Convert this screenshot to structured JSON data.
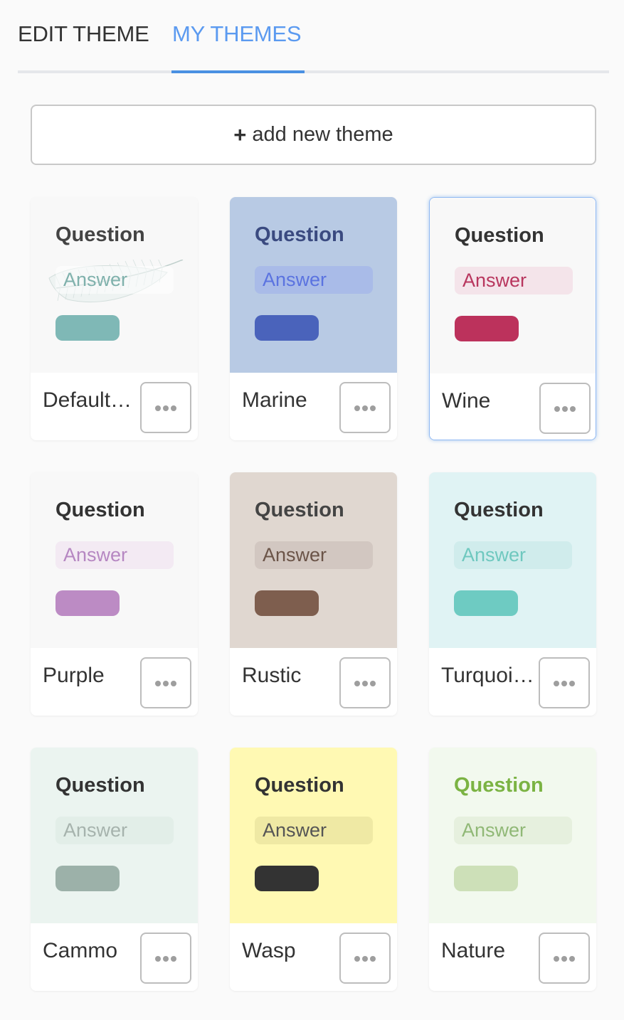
{
  "tabs": {
    "edit_theme": "EDIT THEME",
    "my_themes": "MY THEMES"
  },
  "add_button": {
    "plus": "+",
    "label": "add new theme"
  },
  "more_icon": "more-horizontal-icon",
  "themes": [
    {
      "name": "Default…",
      "question": "Question",
      "answer": "Answer",
      "colors": {
        "bg": "#f8f8f8",
        "question": "#444444",
        "answer_bg": "#ffffff",
        "answer_text": "#7fb1ac",
        "pill": "#7fb8b6"
      },
      "decoration": "feather-icon",
      "selected": false
    },
    {
      "name": "Marine",
      "question": "Question",
      "answer": "Answer",
      "colors": {
        "bg": "#b8cae4",
        "question": "#3a4a80",
        "answer_bg": "#a9bbe8",
        "answer_text": "#5b73e0",
        "pill": "#4a63bb"
      },
      "selected": false
    },
    {
      "name": "Wine",
      "question": "Question",
      "answer": "Answer",
      "colors": {
        "bg": "#f8f8f8",
        "question": "#333333",
        "answer_bg": "#f4e4ea",
        "answer_text": "#b8365e",
        "pill": "#bc325c"
      },
      "selected": true
    },
    {
      "name": "Purple",
      "question": "Question",
      "answer": "Answer",
      "colors": {
        "bg": "#f8f8f8",
        "question": "#333333",
        "answer_bg": "#f3eaf3",
        "answer_text": "#b687c2",
        "pill": "#bc8bc4"
      },
      "selected": false
    },
    {
      "name": "Rustic",
      "question": "Question",
      "answer": "Answer",
      "colors": {
        "bg": "#e0d7d0",
        "question": "#444444",
        "answer_bg": "#d2c7c1",
        "answer_text": "#6b5448",
        "pill": "#7e5e4e"
      },
      "selected": false
    },
    {
      "name": "Turquoi…",
      "question": "Question",
      "answer": "Answer",
      "colors": {
        "bg": "#e0f3f4",
        "question": "#333333",
        "answer_bg": "#d0ecec",
        "answer_text": "#6fc8bf",
        "pill": "#6ecbc2"
      },
      "selected": false
    },
    {
      "name": "Cammo",
      "question": "Question",
      "answer": "Answer",
      "colors": {
        "bg": "#ebf4f0",
        "question": "#333333",
        "answer_bg": "#e2eee8",
        "answer_text": "#a6b3ad",
        "pill": "#9cb1a9"
      },
      "selected": false
    },
    {
      "name": "Wasp",
      "question": "Question",
      "answer": "Answer",
      "colors": {
        "bg": "#fff9b3",
        "question": "#333333",
        "answer_bg": "#efe9a4",
        "answer_text": "#555555",
        "pill": "#333333"
      },
      "selected": false
    },
    {
      "name": "Nature",
      "question": "Question",
      "answer": "Answer",
      "colors": {
        "bg": "#f2f9ee",
        "question": "#7bb343",
        "answer_bg": "#e6f0de",
        "answer_text": "#90b876",
        "pill": "#cde0b8"
      },
      "selected": false
    }
  ]
}
